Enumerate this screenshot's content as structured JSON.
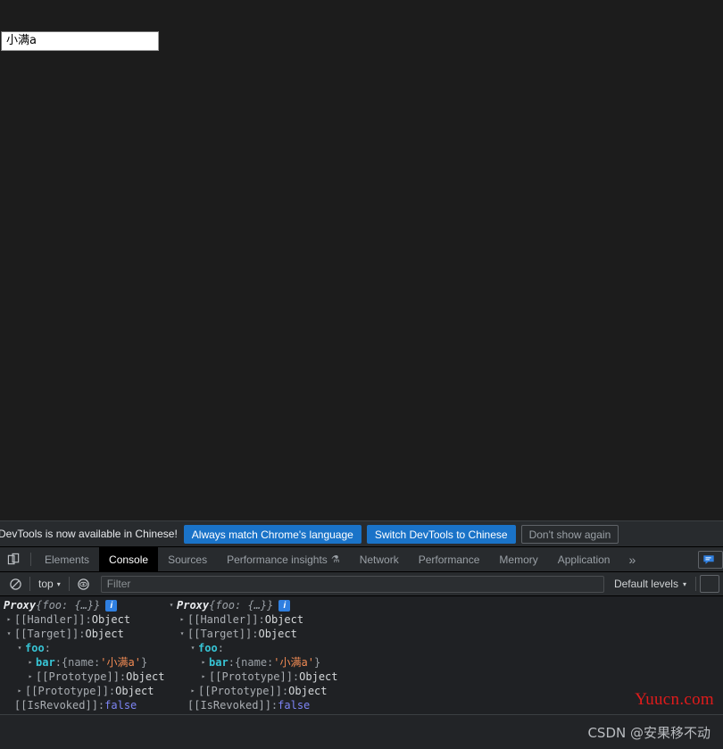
{
  "page": {
    "input_value": "小满a",
    "input_placeholder": ""
  },
  "infobar": {
    "message": "DevTools is now available in Chinese!",
    "buttons": [
      {
        "label": "Always match Chrome's language",
        "style": "primary"
      },
      {
        "label": "Switch DevTools to Chinese",
        "style": "primary"
      },
      {
        "label": "Don't show again",
        "style": "ghost"
      }
    ]
  },
  "tabbar": {
    "dock_icon": "dock-panel-icon",
    "tabs": [
      {
        "label": "Elements",
        "active": false
      },
      {
        "label": "Console",
        "active": true
      },
      {
        "label": "Sources",
        "active": false
      },
      {
        "label": "Performance insights",
        "active": false,
        "icon": "experiment-flask-icon"
      },
      {
        "label": "Network",
        "active": false
      },
      {
        "label": "Performance",
        "active": false
      },
      {
        "label": "Memory",
        "active": false
      },
      {
        "label": "Application",
        "active": false
      }
    ],
    "more_label": "»",
    "issues_icon": "issues-message-icon"
  },
  "console_toolbar": {
    "clear_icon": "clear-console-icon",
    "context_label": "top",
    "context_caret": "▾",
    "eye_icon": "live-expression-eye-icon",
    "filter_placeholder": "Filter",
    "filter_value": "",
    "levels_label": "Default levels",
    "levels_caret": "▾",
    "settings_icon": "settings-gear-icon"
  },
  "console_log": {
    "entries": [
      {
        "header": {
          "type_label": "Proxy",
          "preview": "{foo: {…}}",
          "badge": "i"
        },
        "rows": [
          {
            "tri": "▸",
            "indent": 1,
            "name": "[[Handler]]",
            "sep": ": ",
            "value": "Object",
            "kind": "internal"
          },
          {
            "tri": "▾",
            "indent": 1,
            "name": "[[Target]]",
            "sep": ": ",
            "value": "Object",
            "kind": "internal"
          },
          {
            "tri": "▾",
            "indent": 2,
            "name": "foo",
            "sep": ":",
            "value": "",
            "kind": "key"
          },
          {
            "tri": "▸",
            "indent": 3,
            "name": "bar",
            "sep": ": ",
            "value": "{name: '小满a'}",
            "kind": "key-strobj"
          },
          {
            "tri": "▸",
            "indent": 3,
            "name": "[[Prototype]]",
            "sep": ": ",
            "value": "Object",
            "kind": "internal"
          },
          {
            "tri": "▸",
            "indent": 2,
            "name": "[[Prototype]]",
            "sep": ": ",
            "value": "Object",
            "kind": "internal"
          },
          {
            "tri": "",
            "indent": 1,
            "name": "[[IsRevoked]]",
            "sep": ": ",
            "value": "false",
            "kind": "boolean"
          }
        ]
      },
      {
        "header": {
          "type_label": "Proxy",
          "preview": "{foo: {…}}",
          "badge": "i"
        },
        "rows": [
          {
            "tri": "▸",
            "indent": 1,
            "name": "[[Handler]]",
            "sep": ": ",
            "value": "Object",
            "kind": "internal"
          },
          {
            "tri": "▾",
            "indent": 1,
            "name": "[[Target]]",
            "sep": ": ",
            "value": "Object",
            "kind": "internal"
          },
          {
            "tri": "▾",
            "indent": 2,
            "name": "foo",
            "sep": ":",
            "value": "",
            "kind": "key"
          },
          {
            "tri": "▸",
            "indent": 3,
            "name": "bar",
            "sep": ": ",
            "value": "{name: '小满a'}",
            "kind": "key-strobj"
          },
          {
            "tri": "▸",
            "indent": 3,
            "name": "[[Prototype]]",
            "sep": ": ",
            "value": "Object",
            "kind": "internal"
          },
          {
            "tri": "▸",
            "indent": 2,
            "name": "[[Prototype]]",
            "sep": ": ",
            "value": "Object",
            "kind": "internal"
          },
          {
            "tri": "",
            "indent": 1,
            "name": "[[IsRevoked]]",
            "sep": ": ",
            "value": "false",
            "kind": "boolean"
          }
        ]
      }
    ]
  },
  "watermarks": {
    "site": "Yuucn.com",
    "footer": "CSDN @安果移不动"
  },
  "colors": {
    "page_bg": "#1c1c1c",
    "devtools_bg": "#282b2e",
    "console_bg": "#1f2124",
    "accent_blue": "#1a73c8",
    "key_teal": "#37c5d6",
    "string_orange": "#f28b54",
    "boolean_purple": "#7d85f5",
    "watermark_red": "#e01b1b"
  }
}
